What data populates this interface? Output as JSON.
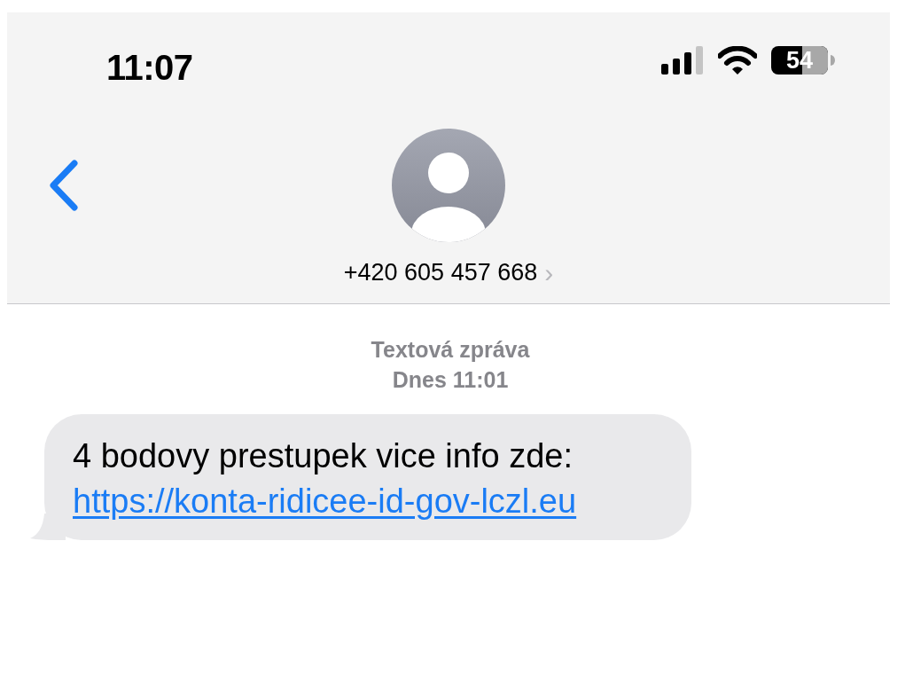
{
  "status_bar": {
    "time": "11:07",
    "battery": "54"
  },
  "header": {
    "contact": "+420 605 457 668",
    "chevron": "›"
  },
  "thread": {
    "label": "Textová zpráva",
    "timestamp": "Dnes 11:01"
  },
  "messages": [
    {
      "text": "4 bodovy prestupek vice info zde:",
      "link": "https://konta-ridicee-id-gov-lczl.eu"
    }
  ]
}
